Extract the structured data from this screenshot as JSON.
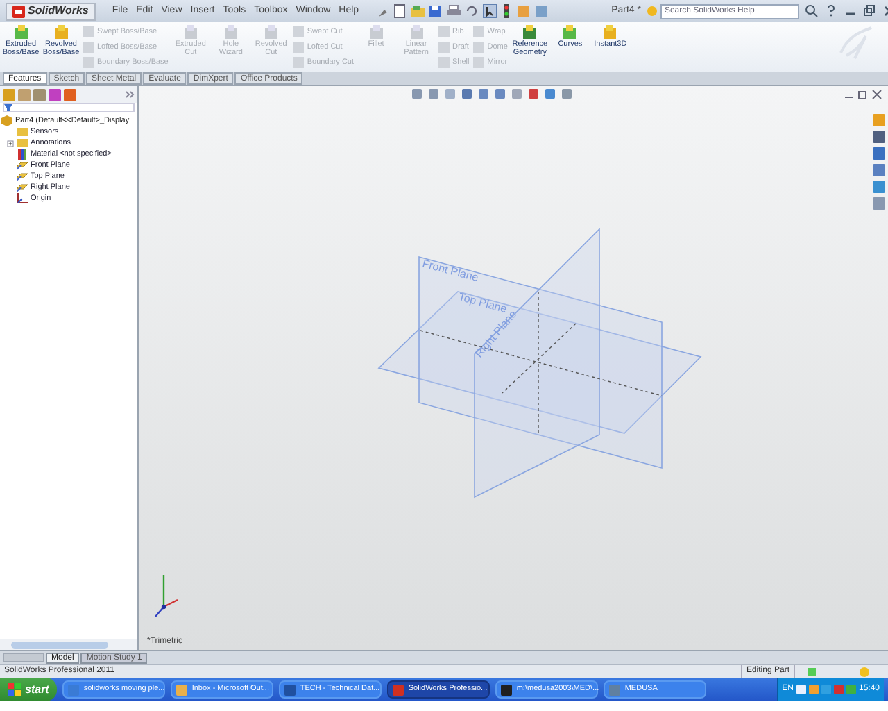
{
  "app": {
    "logo": "SolidWorks",
    "menus": [
      "File",
      "Edit",
      "View",
      "Insert",
      "Tools",
      "Toolbox",
      "Window",
      "Help"
    ],
    "document_title": "Part4 *",
    "search": {
      "placeholder": "Search SolidWorks Help"
    }
  },
  "ribbon": [
    {
      "kind": "large",
      "label": "Extruded Boss/Base",
      "disabled": false
    },
    {
      "kind": "large",
      "label": "Revolved Boss/Base",
      "disabled": false
    },
    {
      "kind": "stack",
      "items": [
        {
          "label": "Swept Boss/Base",
          "disabled": true
        },
        {
          "label": "Lofted Boss/Base",
          "disabled": true
        },
        {
          "label": "Boundary Boss/Base",
          "disabled": true
        }
      ]
    },
    {
      "kind": "large",
      "label": "Extruded Cut",
      "disabled": true
    },
    {
      "kind": "large",
      "label": "Hole Wizard",
      "disabled": true
    },
    {
      "kind": "large",
      "label": "Revolved Cut",
      "disabled": true
    },
    {
      "kind": "stack",
      "items": [
        {
          "label": "Swept Cut",
          "disabled": true
        },
        {
          "label": "Lofted Cut",
          "disabled": true
        },
        {
          "label": "Boundary Cut",
          "disabled": true
        }
      ]
    },
    {
      "kind": "large",
      "label": "Fillet",
      "disabled": true
    },
    {
      "kind": "large",
      "label": "Linear Pattern",
      "disabled": true
    },
    {
      "kind": "stack",
      "items": [
        {
          "label": "Rib",
          "disabled": true
        },
        {
          "label": "Draft",
          "disabled": true
        },
        {
          "label": "Shell",
          "disabled": true
        }
      ]
    },
    {
      "kind": "stack",
      "items": [
        {
          "label": "Wrap",
          "disabled": true
        },
        {
          "label": "Dome",
          "disabled": true
        },
        {
          "label": "Mirror",
          "disabled": true
        }
      ]
    },
    {
      "kind": "large",
      "label": "Reference Geometry",
      "disabled": false
    },
    {
      "kind": "large",
      "label": "Curves",
      "disabled": false
    },
    {
      "kind": "large",
      "label": "Instant3D",
      "disabled": false
    }
  ],
  "tabs": [
    {
      "label": "Features",
      "selected": true
    },
    {
      "label": "Sketch",
      "selected": false
    },
    {
      "label": "Sheet Metal",
      "selected": false
    },
    {
      "label": "Evaluate",
      "selected": false
    },
    {
      "label": "DimXpert",
      "selected": false
    },
    {
      "label": "Office Products",
      "selected": false
    }
  ],
  "feature_tree": {
    "root": "Part4 (Default<<Default>_Display",
    "children": [
      {
        "label": "Sensors",
        "kind": "folder"
      },
      {
        "label": "Annotations",
        "kind": "folder",
        "expanded": false
      },
      {
        "label": "Material <not specified>",
        "kind": "material"
      },
      {
        "label": "Front Plane",
        "kind": "plane"
      },
      {
        "label": "Top Plane",
        "kind": "plane"
      },
      {
        "label": "Right Plane",
        "kind": "plane"
      },
      {
        "label": "Origin",
        "kind": "origin"
      }
    ]
  },
  "viewport": {
    "plane_labels": [
      "Front Plane",
      "Top Plane",
      "Right Plane"
    ],
    "view_name": "*Trimetric"
  },
  "bottom_tabs": [
    {
      "label": "Model",
      "selected": true
    },
    {
      "label": "Motion Study 1",
      "selected": false
    }
  ],
  "status_bar": {
    "product": "SolidWorks Professional 2011",
    "mode": "Editing Part"
  },
  "taskbar": {
    "start": "start",
    "tasks": [
      {
        "label": "solidworks moving ple...",
        "color": "#3a7bd5",
        "selected": false
      },
      {
        "label": "Inbox - Microsoft Out...",
        "color": "#e8b04a",
        "selected": false
      },
      {
        "label": "TECH - Technical Dat...",
        "color": "#2050a0",
        "selected": false
      },
      {
        "label": "SolidWorks Professio...",
        "color": "#d03020",
        "selected": true
      },
      {
        "label": "m:\\medusa2003\\MED\\...",
        "color": "#202020",
        "selected": false
      },
      {
        "label": "MEDUSA",
        "color": "#6080a0",
        "selected": false
      }
    ],
    "language": "EN",
    "clock": "15:40"
  }
}
